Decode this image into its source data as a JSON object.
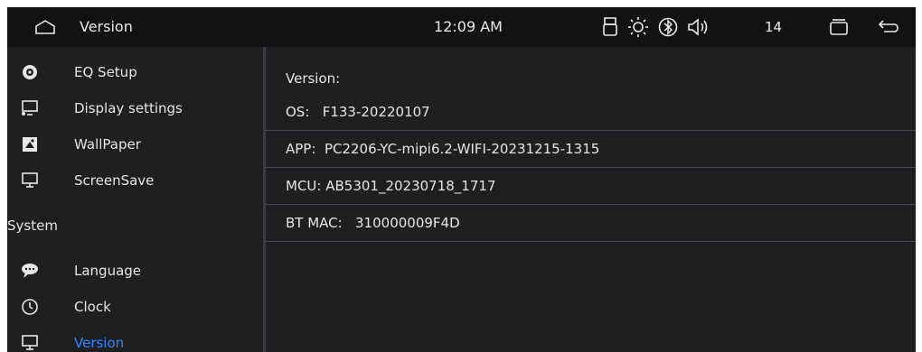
{
  "statusbar": {
    "title": "Version",
    "time": "12:09 AM",
    "volume": "14",
    "icons": [
      "home-icon",
      "usb-icon",
      "brightness-icon",
      "bluetooth-icon",
      "volume-icon",
      "recent-apps-icon",
      "back-icon"
    ]
  },
  "sidebar": {
    "items": [
      {
        "label": "EQ Setup",
        "icon": "eq-icon"
      },
      {
        "label": "Display settings",
        "icon": "display-icon"
      },
      {
        "label": "WallPaper",
        "icon": "wallpaper-icon"
      },
      {
        "label": "ScreenSave",
        "icon": "monitor-icon"
      }
    ],
    "section": "System",
    "system_items": [
      {
        "label": "Language",
        "icon": "chat-icon"
      },
      {
        "label": "Clock",
        "icon": "clock-icon"
      },
      {
        "label": "Version",
        "icon": "monitor-icon"
      }
    ],
    "active": "Version"
  },
  "content": {
    "header": "Version:",
    "rows": [
      {
        "key": "OS:",
        "value": "F133-20220107"
      },
      {
        "key": "APP:",
        "value": "PC2206-YC-mipi6.2-WIFI-20231215-1315"
      },
      {
        "key": "MCU:",
        "value": "AB5301_20230718_1717"
      },
      {
        "key": "BT MAC:",
        "value": "310000009F4D"
      }
    ]
  },
  "colors": {
    "background": "#1e1f21",
    "statusbar": "#111213",
    "text": "#e6e6e6",
    "accent": "#2f86ff",
    "divider": "#4a4b4e"
  }
}
